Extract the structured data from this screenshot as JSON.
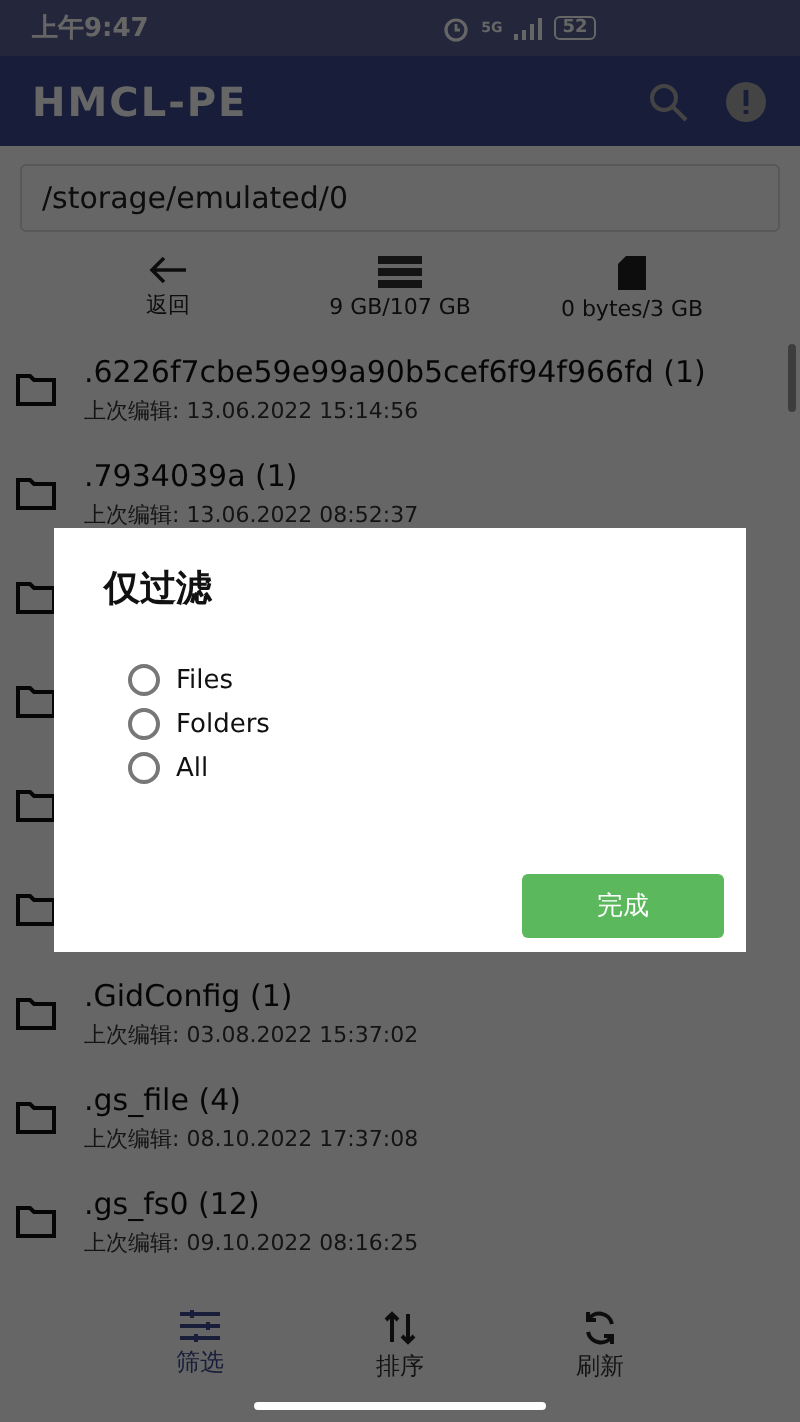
{
  "status_bar": {
    "time": "上午9:47",
    "network": "5G",
    "battery": "52"
  },
  "app_bar": {
    "title": "HMCL-PE"
  },
  "path_field": {
    "value": "/storage/emulated/0"
  },
  "toolbar": [
    {
      "kind": "back",
      "label": "返回"
    },
    {
      "kind": "storage",
      "label": "9 GB/107 GB"
    },
    {
      "kind": "sdcard",
      "label": "0 bytes/3 GB"
    }
  ],
  "files": [
    {
      "kind": "folder",
      "name": ".6226f7cbe59e99a90b5cef6f94f966fd (1)",
      "modified": "上次编辑: 13.06.2022 15:14:56"
    },
    {
      "kind": "folder",
      "name": ".7934039a (1)",
      "modified": "上次编辑: 13.06.2022 08:52:37"
    },
    {
      "kind": "folder"
    },
    {
      "kind": "folder"
    },
    {
      "kind": "folder"
    },
    {
      "kind": "folder"
    },
    {
      "kind": "folder",
      "name": ".GidConfig (1)",
      "modified": "上次编辑: 03.08.2022 15:37:02"
    },
    {
      "kind": "folder",
      "name": ".gs_file (4)",
      "modified": "上次编辑: 08.10.2022 17:37:08"
    },
    {
      "kind": "folder",
      "name": ".gs_fs0 (12)",
      "modified": "上次编辑: 09.10.2022 08:16:25"
    }
  ],
  "bottom_nav": [
    {
      "kind": "filter",
      "label": "筛选",
      "selected": true
    },
    {
      "kind": "sort",
      "label": "排序",
      "selected": false
    },
    {
      "kind": "refresh",
      "label": "刷新",
      "selected": false
    }
  ],
  "dialog": {
    "title": "仅过滤",
    "options": [
      {
        "label": "Files",
        "selected": false
      },
      {
        "label": "Folders",
        "selected": false
      },
      {
        "label": "All",
        "selected": false
      }
    ],
    "button": "完成"
  }
}
